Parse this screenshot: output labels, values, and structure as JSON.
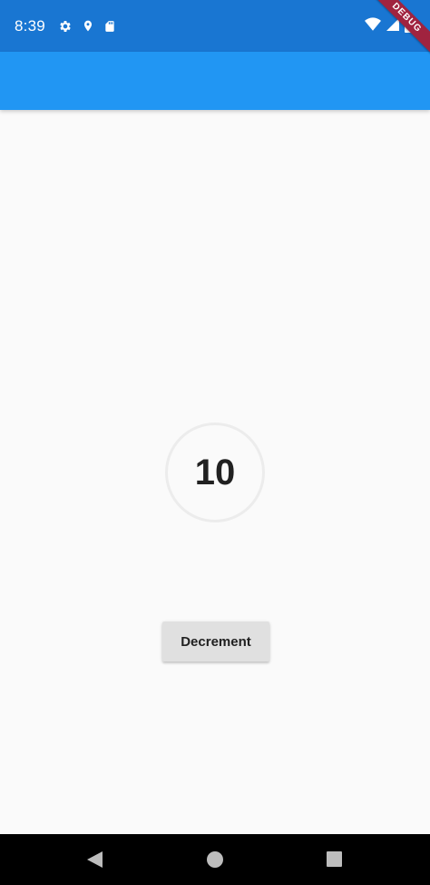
{
  "status_bar": {
    "time": "8:39",
    "left_icons": [
      "gear-icon",
      "location-pin-icon",
      "sd-card-icon"
    ],
    "right_icons": [
      "wifi-icon",
      "cell-signal-icon",
      "battery-icon"
    ]
  },
  "debug_ribbon": {
    "label": "DEBUG"
  },
  "counter": {
    "value": "10"
  },
  "decrement_button": {
    "label": "Decrement"
  },
  "nav_bar": {
    "icons": [
      "back-icon",
      "home-icon",
      "recents-icon"
    ]
  },
  "colors": {
    "status_bar": "#1976d2",
    "app_bar": "#2196f3",
    "background": "#fafafa",
    "button": "#e0e0e0",
    "ribbon": "#a0233f"
  }
}
